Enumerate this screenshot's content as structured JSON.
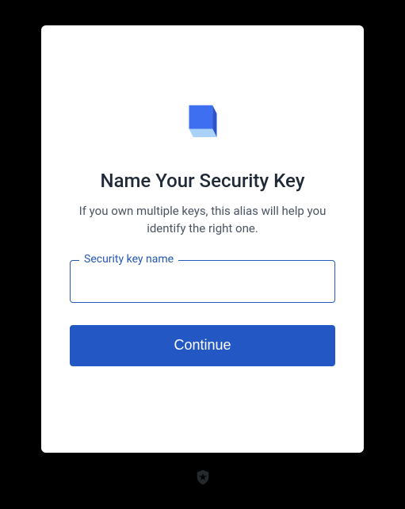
{
  "dialog": {
    "title": "Name Your Security Key",
    "subtitle": "If you own multiple keys, this alias will help you identify the right one.",
    "field": {
      "label": "Security key name",
      "value": ""
    },
    "continue_label": "Continue"
  }
}
